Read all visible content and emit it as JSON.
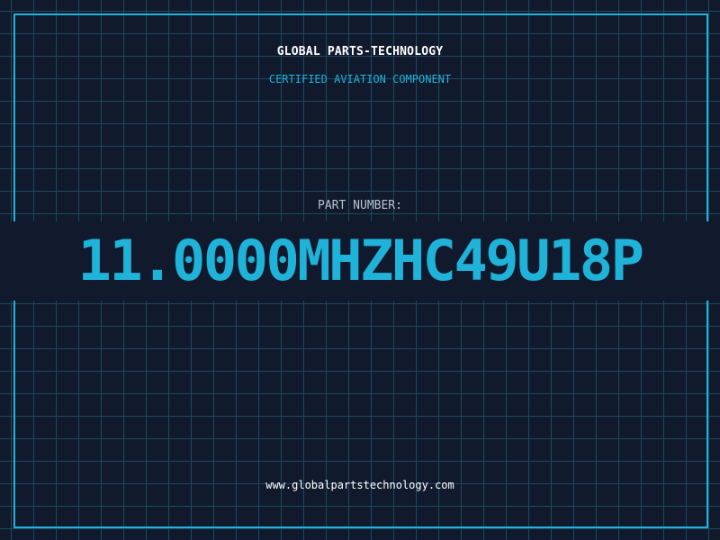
{
  "header": {
    "brand": "GLOBAL PARTS-TECHNOLOGY",
    "subtitle": "CERTIFIED AVIATION COMPONENT"
  },
  "part": {
    "label": "PART NUMBER:",
    "number": "11.0000MHZHC49U18P"
  },
  "footer": {
    "url": "www.globalpartstechnology.com"
  },
  "colors": {
    "background": "#111a2d",
    "grid": "#1d4760",
    "accent": "#1fb3d9",
    "text": "#ffffff",
    "muted": "#b9c2cf"
  }
}
